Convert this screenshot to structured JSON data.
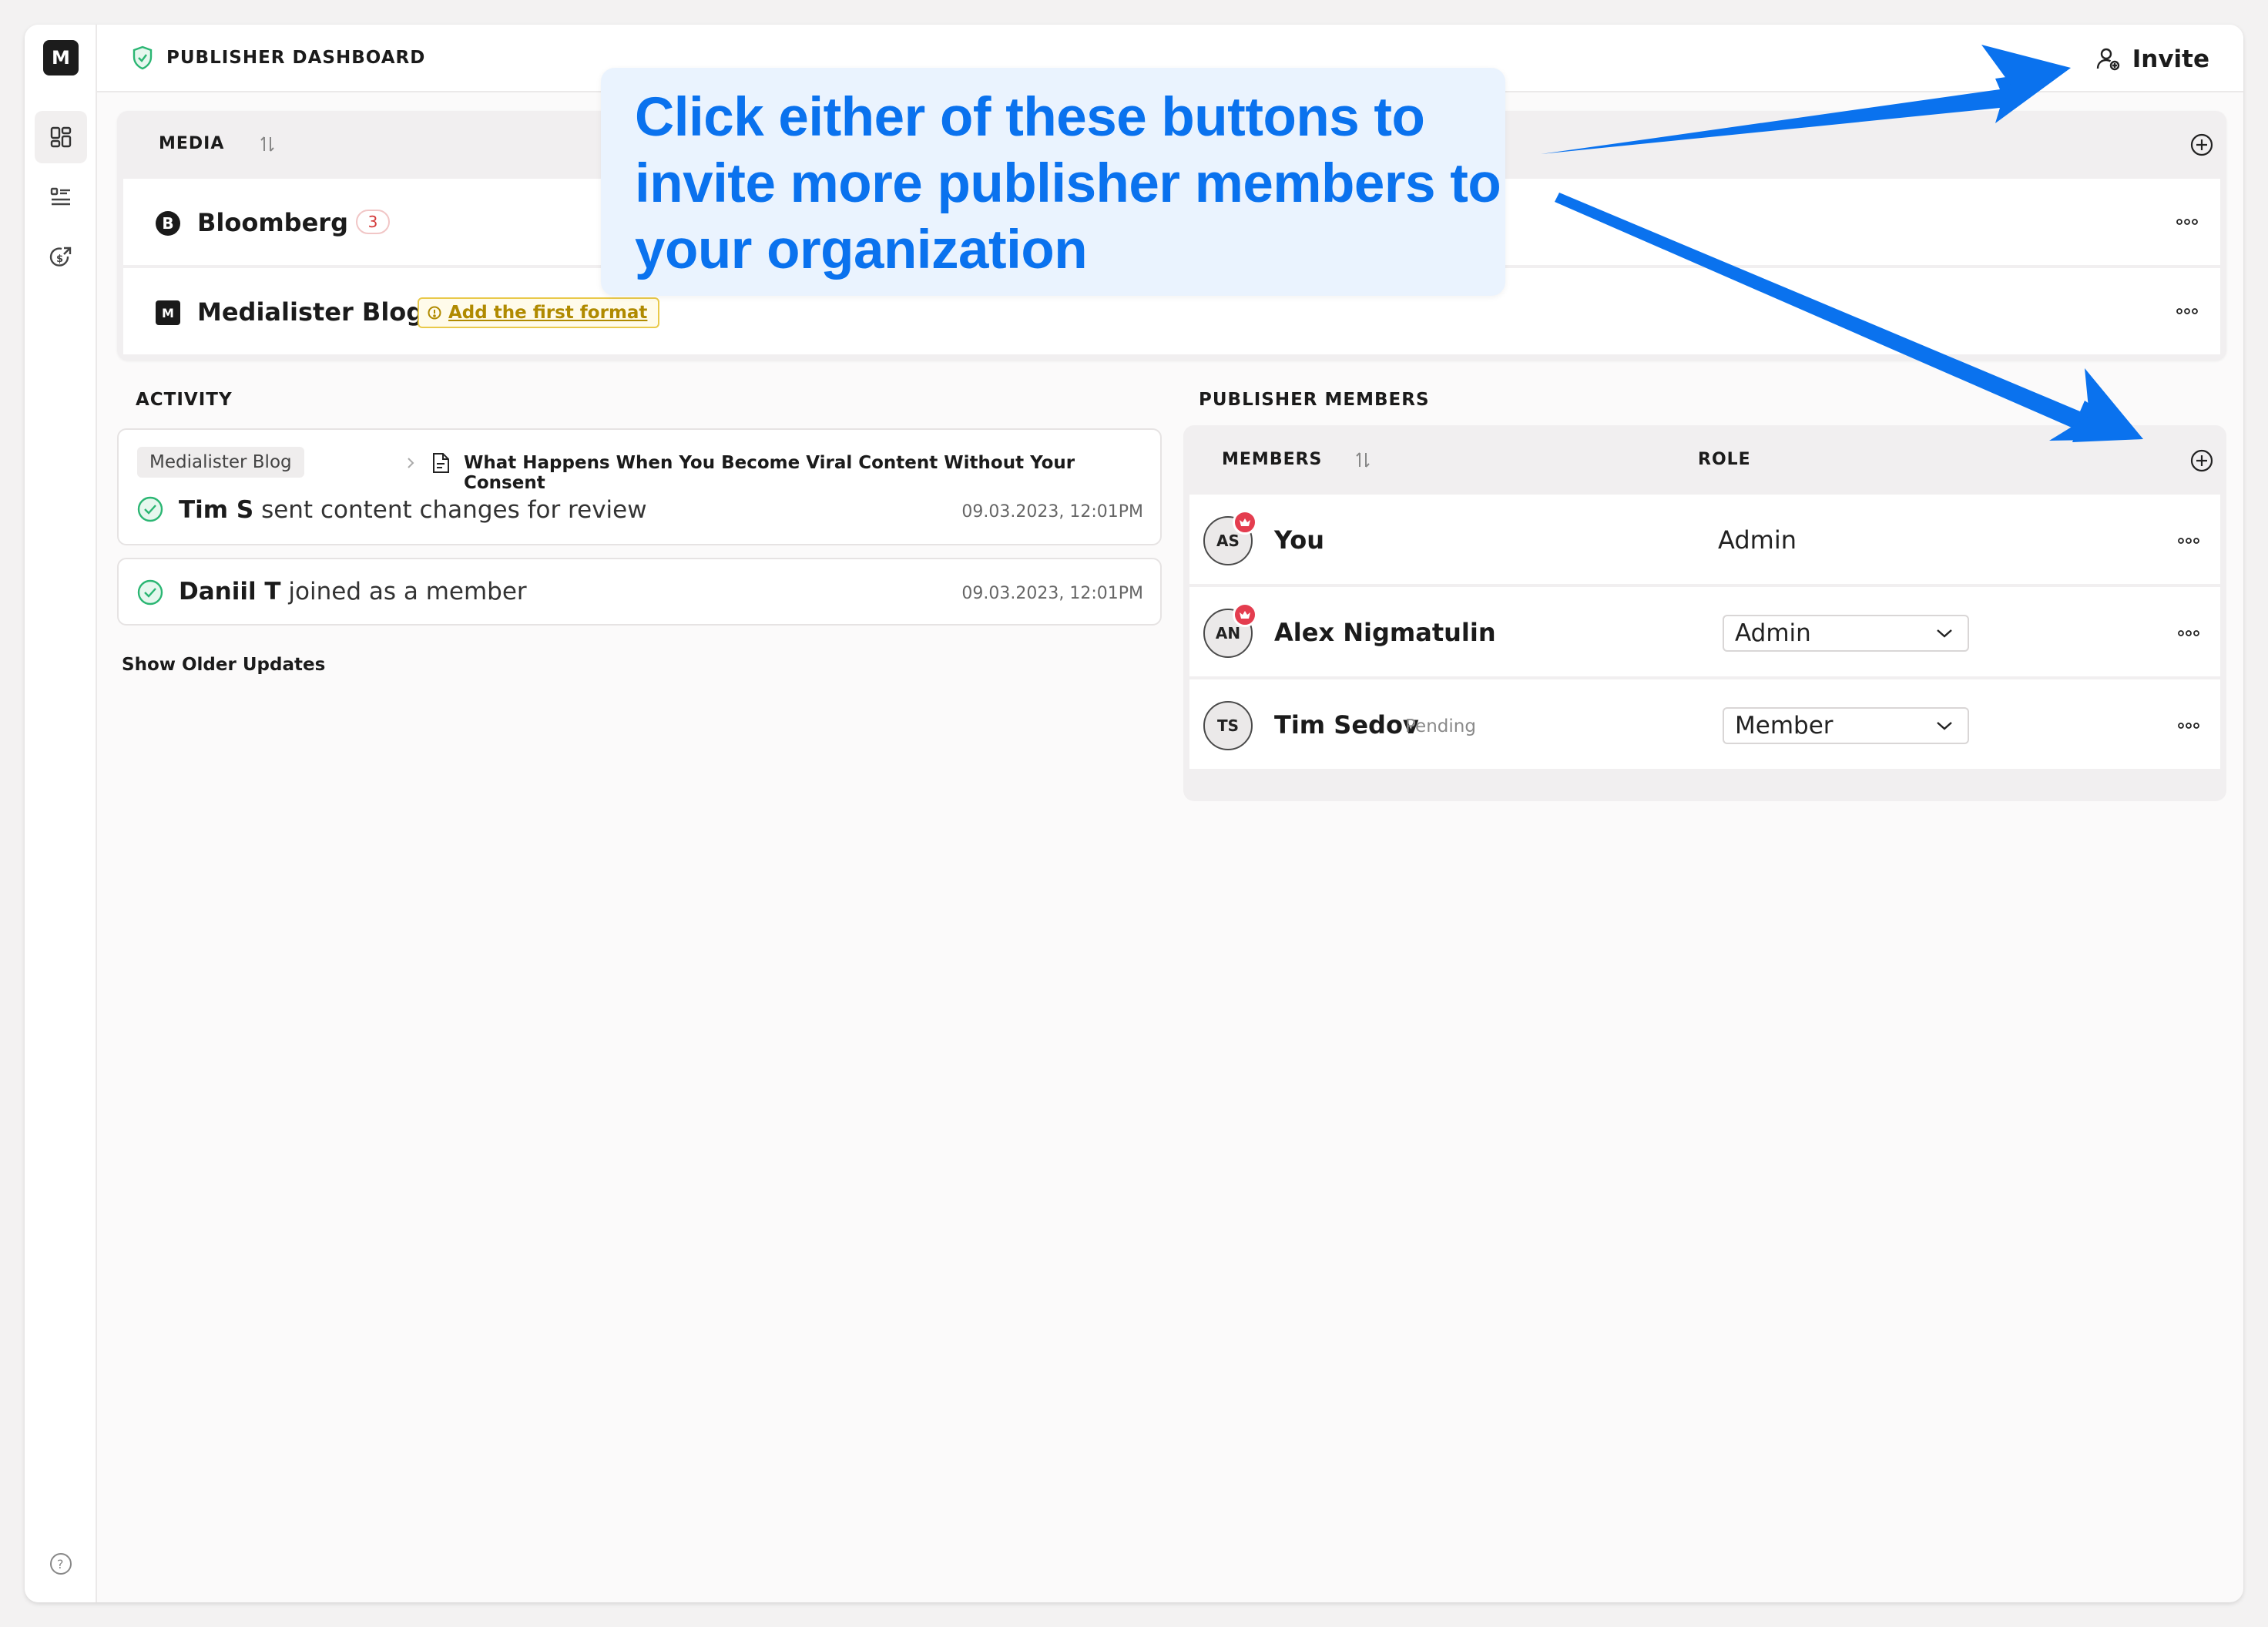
{
  "app": {
    "logo_letter": "M",
    "page_title": "PUBLISHER DASHBOARD",
    "invite_label": "Invite",
    "accent_color": "#0a72ee"
  },
  "sidebar": {
    "items": [
      {
        "icon": "dashboard-icon",
        "active": true
      },
      {
        "icon": "list-icon",
        "active": false
      },
      {
        "icon": "monetization-icon",
        "active": false
      }
    ],
    "help_icon": "help-icon"
  },
  "media": {
    "header": "MEDIA",
    "rows": [
      {
        "logo": "B",
        "name": "Bloomberg",
        "count": "3"
      },
      {
        "logo": "M",
        "name": "Medialister Blog",
        "format_link": "Add the first format"
      }
    ]
  },
  "activity": {
    "title": "ACTIVITY",
    "items": [
      {
        "chip": "Medialister Blog",
        "article": "What Happens When You Become Viral Content Without Your Consent",
        "actor": "Tim S",
        "action": "sent content changes for review",
        "time": "09.03.2023, 12:01PM"
      },
      {
        "actor": "Daniil T",
        "action": "joined as a member",
        "time": "09.03.2023, 12:01PM"
      }
    ],
    "show_older": "Show Older Updates"
  },
  "members": {
    "title": "PUBLISHER MEMBERS",
    "col_members": "MEMBERS",
    "col_role": "ROLE",
    "rows": [
      {
        "initials": "AS",
        "name": "You",
        "role": "Admin",
        "owner": true,
        "editable": false
      },
      {
        "initials": "AN",
        "name": "Alex Nigmatulin",
        "role": "Admin",
        "owner": true,
        "editable": true
      },
      {
        "initials": "TS",
        "name": "Tim Sedov",
        "status": "Pending",
        "role": "Member",
        "owner": false,
        "editable": true
      }
    ]
  },
  "annotation": {
    "lines": [
      "Click either of these buttons to",
      "invite more publisher members to",
      "your organization"
    ]
  }
}
